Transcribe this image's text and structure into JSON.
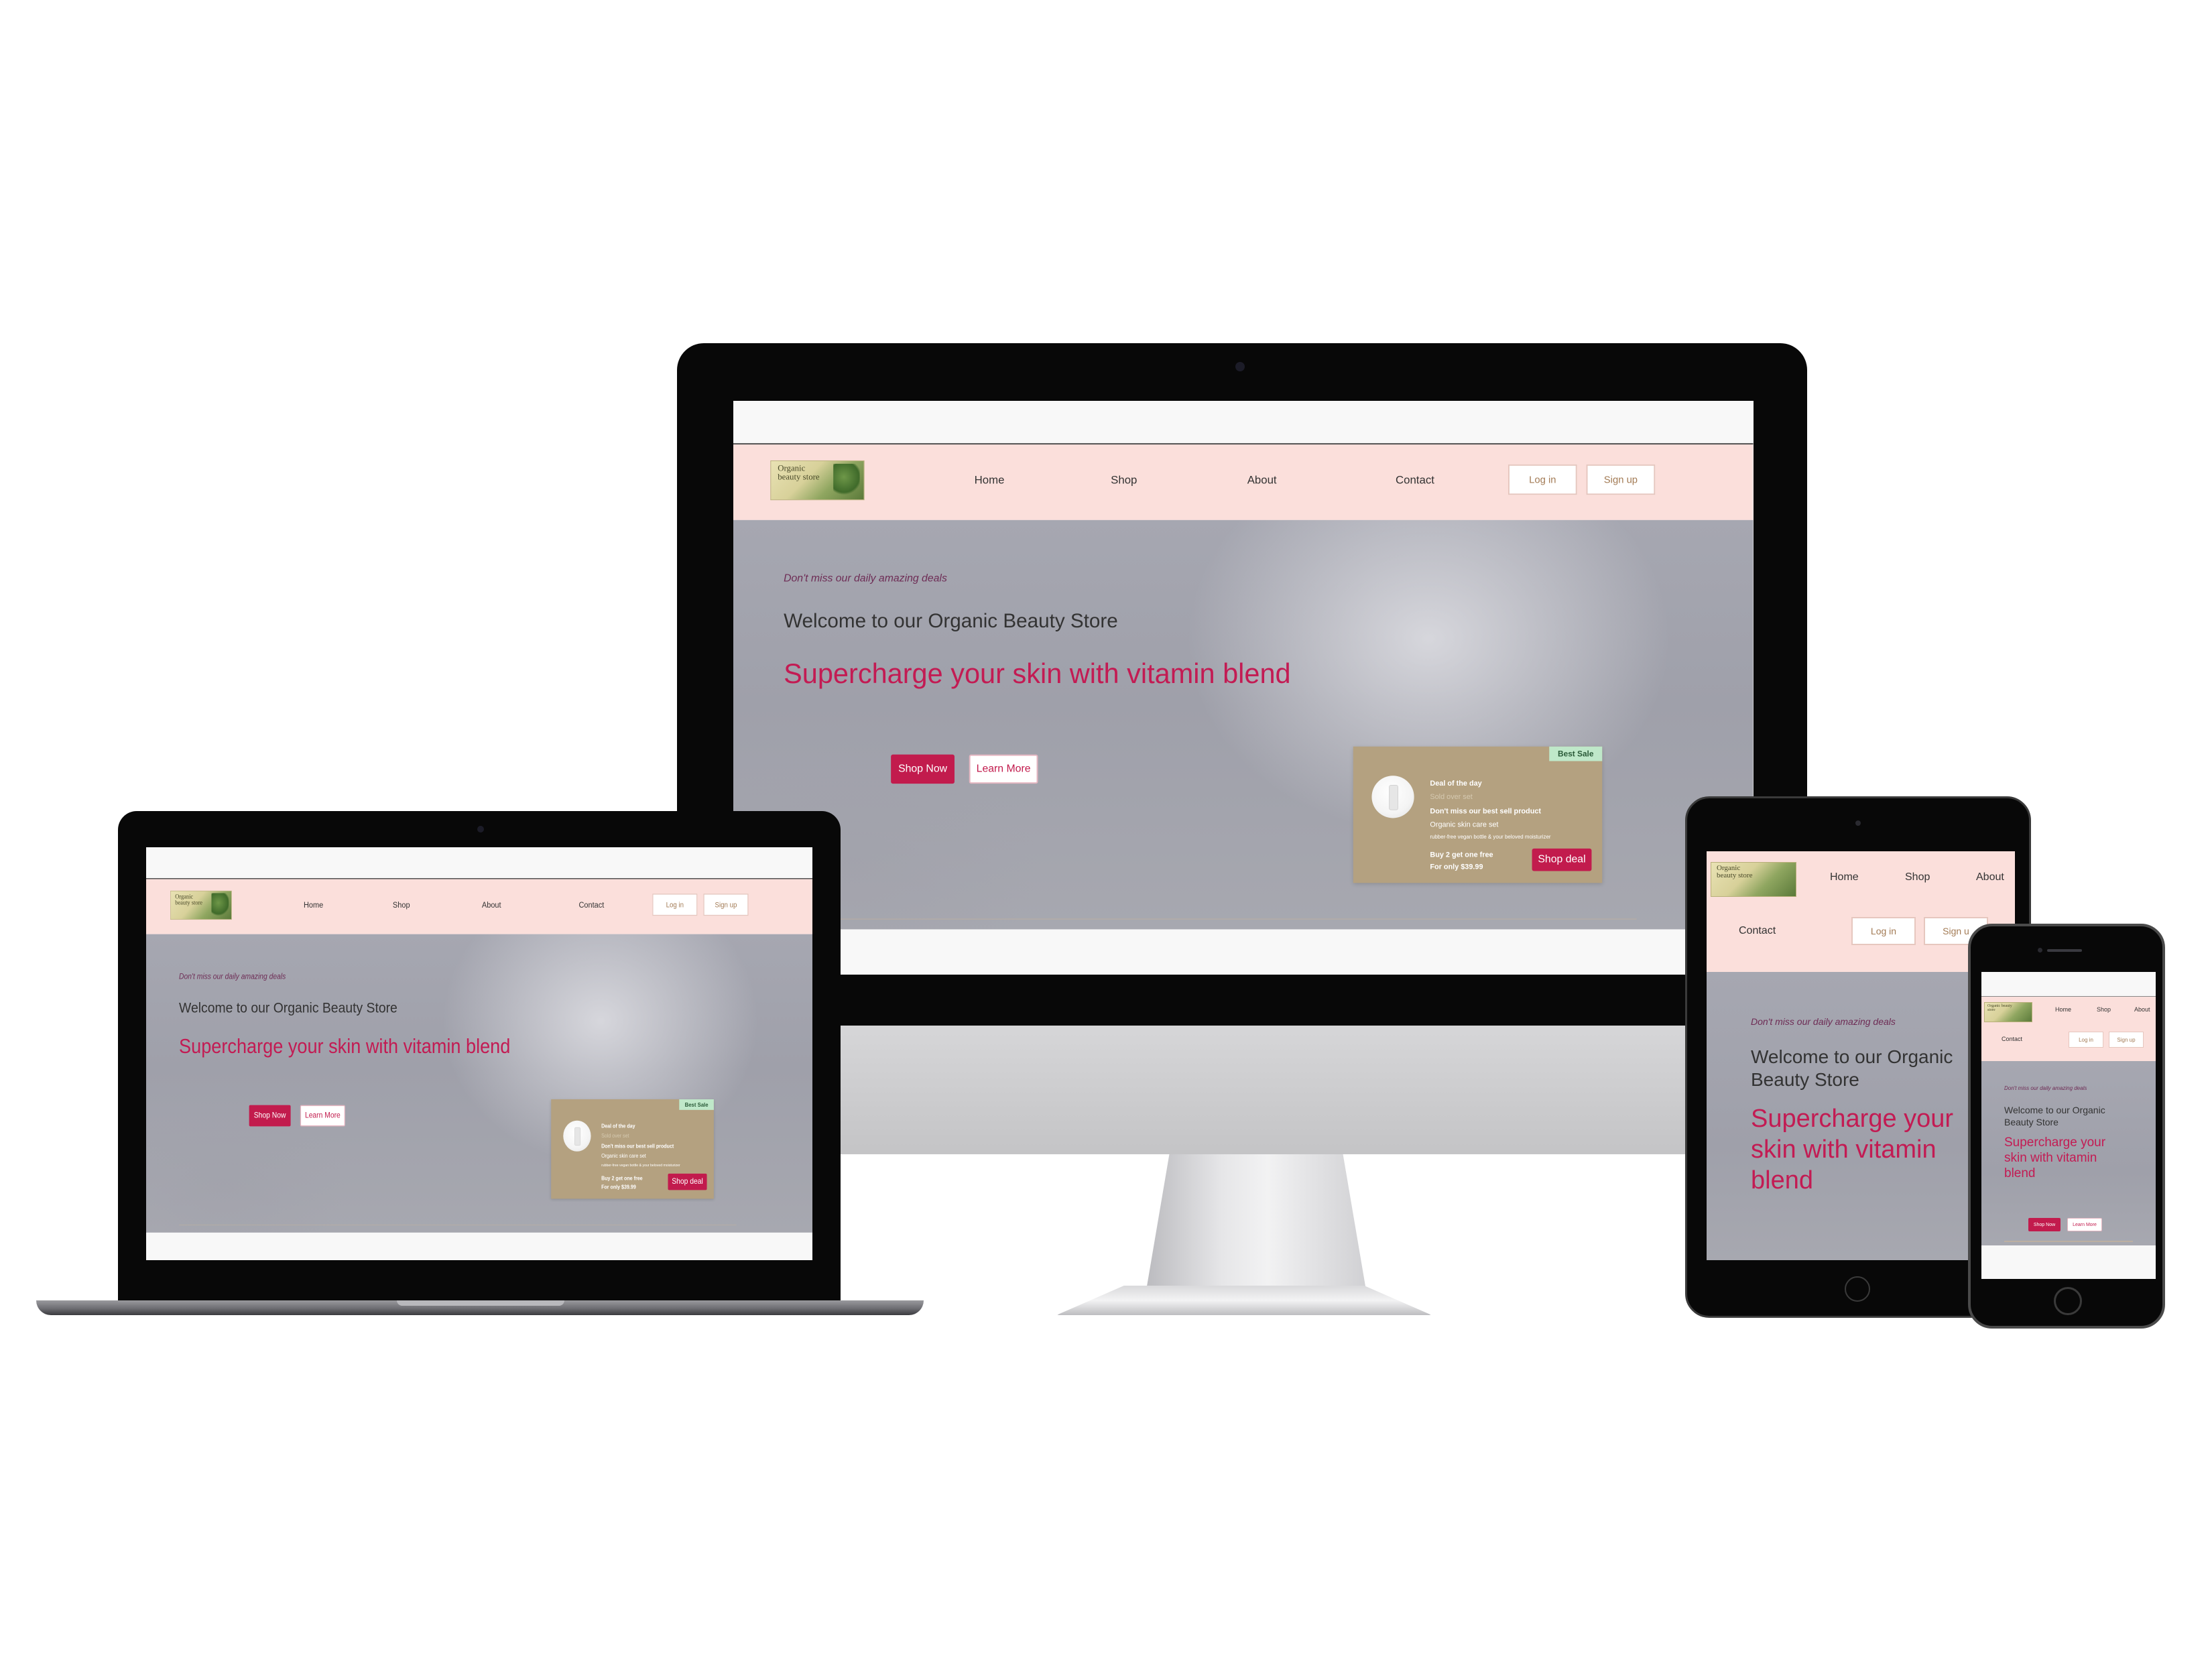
{
  "site": {
    "logo_text": "Organic beauty store",
    "nav": [
      "Home",
      "Shop",
      "About",
      "Contact"
    ],
    "login": "Log in",
    "signup": "Sign up",
    "signup_cut": "Sign u",
    "tagline": "Don't miss our daily amazing deals",
    "welcome": "Welcome to our Organic Beauty Store",
    "welcome_line1": "Welcome to our Organic",
    "welcome_line2": "Beauty Store",
    "headline": "Supercharge your skin with vitamin blend",
    "headline_l1": "Supercharge your",
    "headline_l2": "skin with vitamin",
    "headline_l3": "blend",
    "shop_now": "Shop Now",
    "learn_more": "Learn More",
    "deal": {
      "badge": "Best Sale",
      "title": "Deal of the day",
      "subtitle": "Sold over set",
      "line1": "Don't miss our best sell product",
      "line2": "Organic skin care set",
      "line3": "rubber-free vegan bottle & your beloved moisturizer",
      "offer": "Buy 2 get one free",
      "price": "For only $39.99",
      "cta": "Shop deal"
    }
  },
  "colors": {
    "nav_bg": "#fbdfdb",
    "accent": "#c21b4d",
    "headline": "#c31b53",
    "tagline": "#6e2c55",
    "deal_bg": "#b4a180",
    "badge_bg": "#bfe8c9"
  },
  "icons": {
    "camera": "camera-icon",
    "home_button": "home-button-icon",
    "speaker": "speaker-icon"
  }
}
